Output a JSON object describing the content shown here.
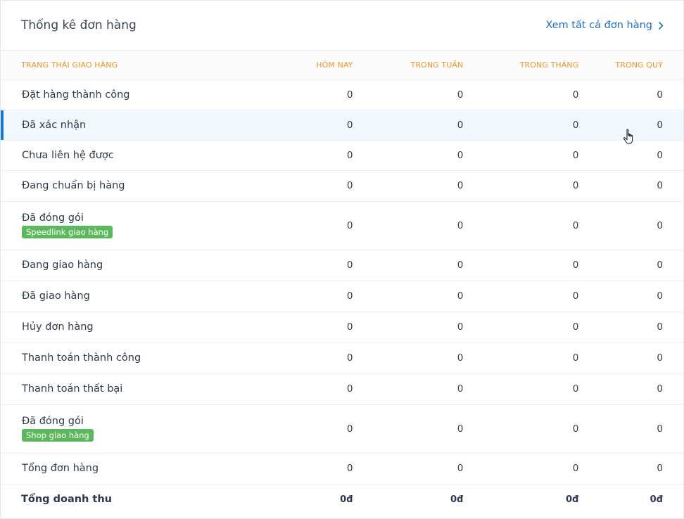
{
  "header": {
    "title": "Thống kê đơn hàng",
    "view_all": "Xem tất cả đơn hàng"
  },
  "table": {
    "columns": [
      "TRẠNG THÁI GIAO HÀNG",
      "HÔM NAY",
      "TRONG TUẦN",
      "TRONG THÁNG",
      "TRONG QUÝ"
    ],
    "rows": [
      {
        "label": "Đặt hàng thành công",
        "values": [
          "0",
          "0",
          "0",
          "0"
        ]
      },
      {
        "label": "Đã xác nhận",
        "values": [
          "0",
          "0",
          "0",
          "0"
        ]
      },
      {
        "label": "Chưa liên hệ được",
        "values": [
          "0",
          "0",
          "0",
          "0"
        ]
      },
      {
        "label": "Đang chuẩn bị hàng",
        "values": [
          "0",
          "0",
          "0",
          "0"
        ]
      },
      {
        "label": "Đã đóng gói",
        "badge": "Speedlink giao hàng",
        "values": [
          "0",
          "0",
          "0",
          "0"
        ]
      },
      {
        "label": "Đang giao hàng",
        "values": [
          "0",
          "0",
          "0",
          "0"
        ]
      },
      {
        "label": "Đã giao hàng",
        "values": [
          "0",
          "0",
          "0",
          "0"
        ]
      },
      {
        "label": "Hủy đơn hàng",
        "values": [
          "0",
          "0",
          "0",
          "0"
        ]
      },
      {
        "label": "Thanh toán thành công",
        "values": [
          "0",
          "0",
          "0",
          "0"
        ]
      },
      {
        "label": "Thanh toán thất bại",
        "values": [
          "0",
          "0",
          "0",
          "0"
        ]
      },
      {
        "label": "Đã đóng gói",
        "badge": "Shop giao hàng",
        "values": [
          "0",
          "0",
          "0",
          "0"
        ]
      },
      {
        "label": "Tổng đơn hàng",
        "values": [
          "0",
          "0",
          "0",
          "0"
        ]
      }
    ],
    "total": {
      "label": "Tổng doanh thu",
      "values": [
        "0đ",
        "0đ",
        "0đ",
        "0đ"
      ]
    }
  },
  "colors": {
    "accent": "#1f6fc5",
    "header_text": "#f0962e",
    "badge": "#5cb85c",
    "active_bar": "#1478d4"
  },
  "icons": {
    "view_all": "chevron-right-icon",
    "cursor": "hand-pointer-cursor-icon"
  }
}
